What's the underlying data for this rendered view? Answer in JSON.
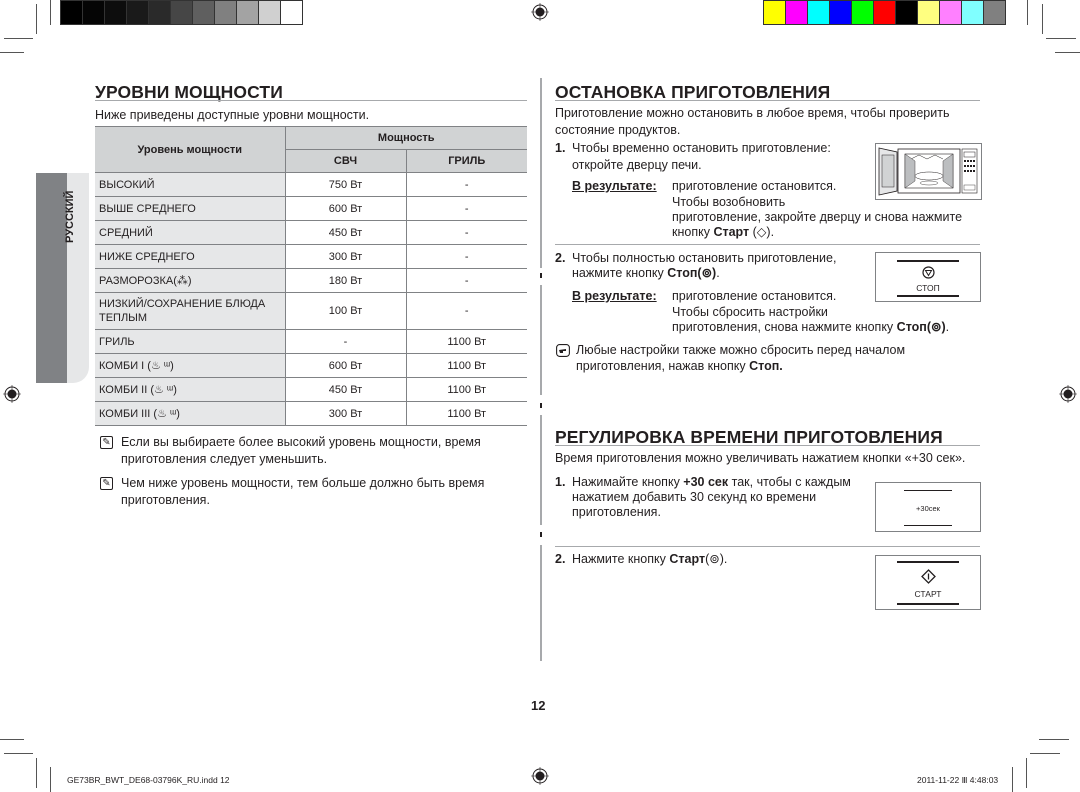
{
  "print_marks": {
    "gray_swatches": [
      "#000000",
      "#050505",
      "#0d0d0d",
      "#1a1a1a",
      "#2a2a2a",
      "#464646",
      "#5f5f5f",
      "#808080",
      "#a3a3a3",
      "#d0d0d0",
      "#ffffff"
    ],
    "color_swatches": [
      "#ffff00",
      "#ff00ff",
      "#00ffff",
      "#0000ff",
      "#00ff00",
      "#ff0000",
      "#000000",
      "#ffff80",
      "#ff80ff",
      "#80ffff",
      "#808080"
    ]
  },
  "sidebar": {
    "language_tab": "РУССКИЙ"
  },
  "power_levels": {
    "title": "УРОВНИ МОЩНОСТИ",
    "intro": "Ниже приведены доступные уровни мощности.",
    "table": {
      "col_level": "Уровень мощности",
      "col_power": "Мощность",
      "col_mw": "СВЧ",
      "col_grill": "ГРИЛЬ",
      "rows": [
        {
          "level": "ВЫСОКИЙ",
          "mw": "750 Вт",
          "grill": "-"
        },
        {
          "level": "ВЫШЕ СРЕДНЕГО",
          "mw": "600 Вт",
          "grill": "-"
        },
        {
          "level": "СРЕДНИЙ",
          "mw": "450 Вт",
          "grill": "-"
        },
        {
          "level": "НИЖЕ СРЕДНЕГО",
          "mw": "300 Вт",
          "grill": "-"
        },
        {
          "level": "РАЗМОРОЗКА(⁂)",
          "mw": "180 Вт",
          "grill": "-"
        },
        {
          "level": "НИЗКИЙ/СОХРАНЕНИЕ БЛЮДА ТЕПЛЫМ",
          "mw": "100 Вт",
          "grill": "-"
        },
        {
          "level": "ГРИЛЬ",
          "mw": "-",
          "grill": "1100 Вт"
        },
        {
          "level": "КОМБИ I (♨ ᵚ)",
          "mw": "600 Вт",
          "grill": "1100 Вт"
        },
        {
          "level": "КОМБИ II (♨ ᵚ)",
          "mw": "450 Вт",
          "grill": "1100 Вт"
        },
        {
          "level": "КОМБИ III (♨ ᵚ)",
          "mw": "300 Вт",
          "grill": "1100 Вт"
        }
      ]
    },
    "notes": [
      "Если вы выбираете более высокий уровень мощности, время приготовления следует уменьшить.",
      "Чем ниже уровень мощности, тем больше должно быть время приготовления."
    ]
  },
  "stop_cooking": {
    "title": "ОСТАНОВКА ПРИГОТОВЛЕНИЯ",
    "intro": "Приготовление можно остановить в любое время, чтобы проверить состояние продуктов.",
    "step1_num": "1.",
    "step1_text": "Чтобы временно остановить приготовление: откройте дверцу печи.",
    "result_label": "В результате:",
    "step1_result_a": "приготовление остановится.",
    "step1_result_b": "Чтобы возобновить",
    "step1_result_c": "приготовление, закройте дверцу и снова нажмите",
    "step1_result_d_pre": "кнопку",
    "step1_result_d_bold": "Старт",
    "step1_result_d_post": "(◇).",
    "step2_num": "2.",
    "step2_line1": "Чтобы полностью остановить приготовление,",
    "step2_line2_pre": "нажмите кнопку",
    "step2_line2_bold": "Стоп(⊚)",
    "step2_line2_post": ".",
    "step2_result_a": "приготовление остановится.",
    "step2_result_b": "Чтобы сбросить настройки",
    "step2_result_c_pre": "приготовления, снова нажмите кнопку",
    "step2_result_c_bold": "Стоп(⊚)",
    "step2_result_c_post": ".",
    "tip_line1": "Любые настройки также можно сбросить перед началом",
    "tip_line2_pre": "приготовления, нажав кнопку",
    "tip_line2_bold": "Стоп.",
    "stop_panel_label": "СТОП"
  },
  "adjust_time": {
    "title": "РЕГУЛИРОВКА ВРЕМЕНИ ПРИГОТОВЛЕНИЯ",
    "intro": "Время приготовления можно увеличивать нажатием кнопки «+30 сек».",
    "step1_num": "1.",
    "step1_pre": "Нажимайте кнопку",
    "step1_bold": "+30 сек",
    "step1_post": "так, чтобы с каждым",
    "step1_line2": "нажатием добавить 30 секунд ко времени",
    "step1_line3": "приготовления.",
    "plus30_panel_label": "+30сек",
    "step2_num": "2.",
    "step2_pre": "Нажмите кнопку",
    "step2_bold": "Старт",
    "step2_post": "(⊚).",
    "start_panel_label": "СТАРТ"
  },
  "page_number": "12",
  "footer": {
    "file": "GE73BR_BWT_DE68-03796K_RU.indd   12",
    "timestamp": "2011-11-22   Ⅲ 4:48:03"
  }
}
